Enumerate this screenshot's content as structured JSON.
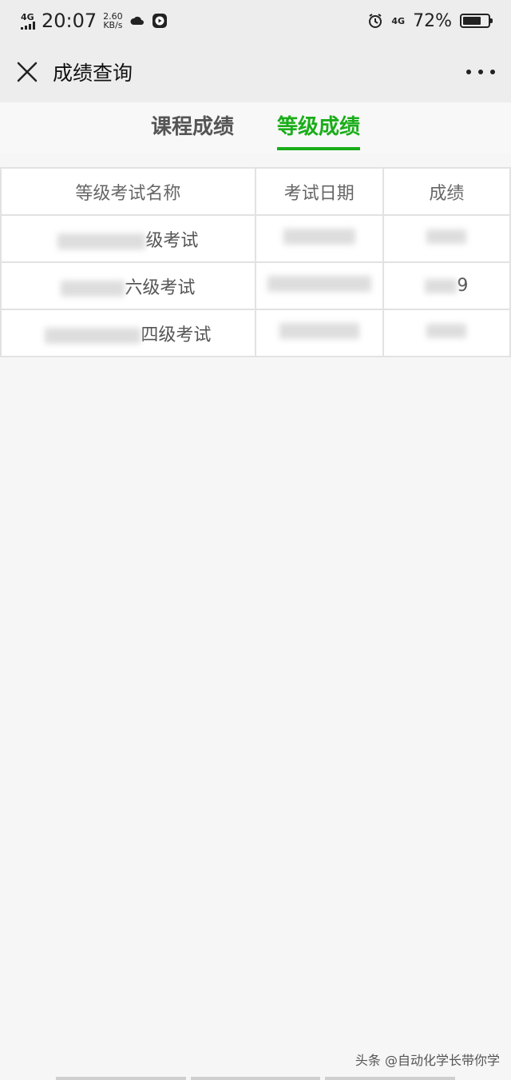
{
  "status_bar": {
    "network": "4G",
    "time": "20:07",
    "speed_value": "2.60",
    "speed_unit": "KB/s",
    "network_right": "4G",
    "battery_percent": "72%",
    "battery_level": 0.72
  },
  "nav": {
    "title": "成绩查询"
  },
  "tabs": [
    {
      "label": "课程成绩",
      "active": false
    },
    {
      "label": "等级成绩",
      "active": true
    }
  ],
  "table": {
    "headers": [
      "等级考试名称",
      "考试日期",
      "成绩"
    ],
    "rows": [
      {
        "name": "级考试",
        "date": "",
        "score": ""
      },
      {
        "name": "六级考试",
        "date": "",
        "score": "9"
      },
      {
        "name": "四级考试",
        "date": "",
        "score": ""
      }
    ]
  },
  "watermark": "头条 @自动化学长带你学"
}
